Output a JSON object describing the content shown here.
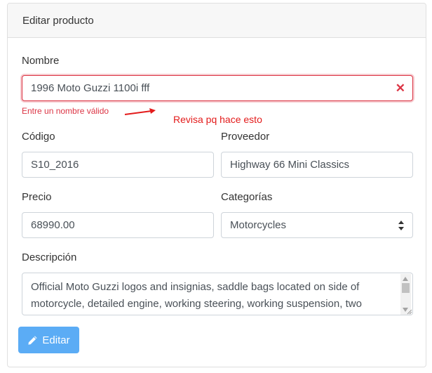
{
  "card": {
    "title": "Editar producto"
  },
  "form": {
    "nombre": {
      "label": "Nombre",
      "value": "1996 Moto Guzzi 1100i fff",
      "error": "Entre un nombre válido"
    },
    "annotation": "Revisa pq hace esto",
    "codigo": {
      "label": "Código",
      "value": "S10_2016"
    },
    "proveedor": {
      "label": "Proveedor",
      "value": "Highway 66 Mini Classics"
    },
    "precio": {
      "label": "Precio",
      "value": "68990.00"
    },
    "categorias": {
      "label": "Categorías",
      "selected": "Motorcycles"
    },
    "descripcion": {
      "label": "Descripción",
      "value": "Official Moto Guzzi logos and insignias, saddle bags located on side of motorcycle, detailed engine, working steering, working suspension, two"
    },
    "submit_label": "Editar"
  },
  "colors": {
    "error": "#dc3545",
    "annotation": "#e31b1b",
    "button": "#5bacf5"
  },
  "icons": {
    "clear": "close-icon",
    "edit": "pencil-icon",
    "select": "sort-arrows-icon"
  }
}
